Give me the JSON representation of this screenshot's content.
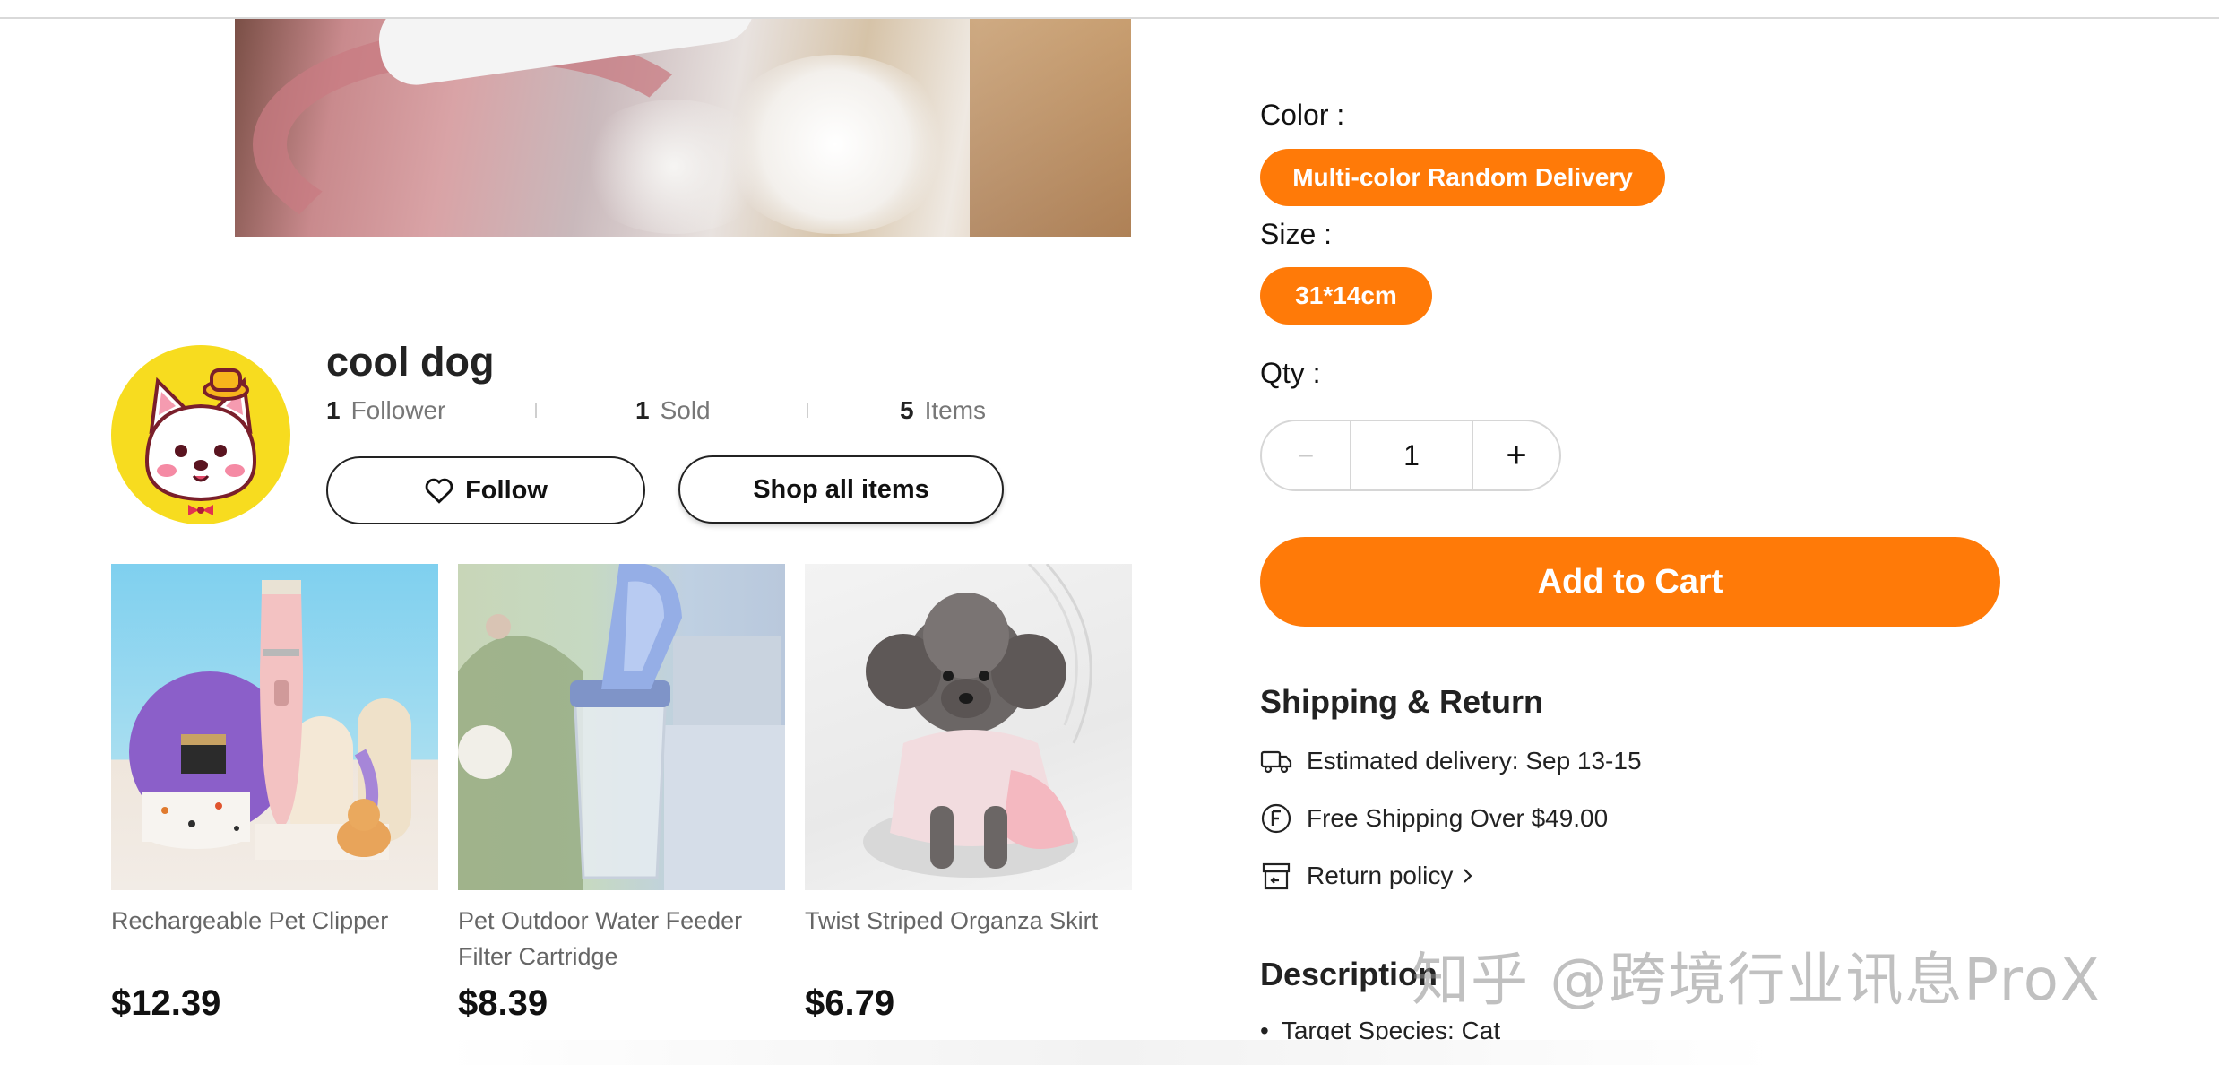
{
  "store": {
    "name": "cool dog",
    "stats": [
      {
        "count": "1",
        "label": "Follower"
      },
      {
        "count": "1",
        "label": "Sold"
      },
      {
        "count": "5",
        "label": "Items"
      }
    ],
    "follow_label": "Follow",
    "shop_all_label": "Shop all items"
  },
  "products": [
    {
      "name": "Rechargeable Pet Clipper",
      "price": "$12.39"
    },
    {
      "name": "Pet Outdoor Water Feeder Filter Cartridge",
      "price": "$8.39"
    },
    {
      "name": "Twist Striped Organza Skirt",
      "price": "$6.79"
    }
  ],
  "options": {
    "color_label": "Color :",
    "color_value": "Multi-color Random Delivery",
    "size_label": "Size :",
    "size_value": "31*14cm",
    "qty_label": "Qty :",
    "qty_minus": "−",
    "qty_value": "1",
    "qty_plus": "+"
  },
  "cart": {
    "add_label": "Add to Cart"
  },
  "shipping": {
    "title": "Shipping & Return",
    "delivery": "Estimated delivery: Sep 13-15",
    "free_shipping": "Free Shipping Over $49.00",
    "return_policy": "Return policy"
  },
  "description": {
    "title": "Description",
    "items": [
      "Target Species: Cat"
    ]
  },
  "watermark": "知乎 @跨境行业讯息ProX",
  "colors": {
    "accent": "#ff7a08",
    "avatar_bg": "#f7dc1f"
  }
}
